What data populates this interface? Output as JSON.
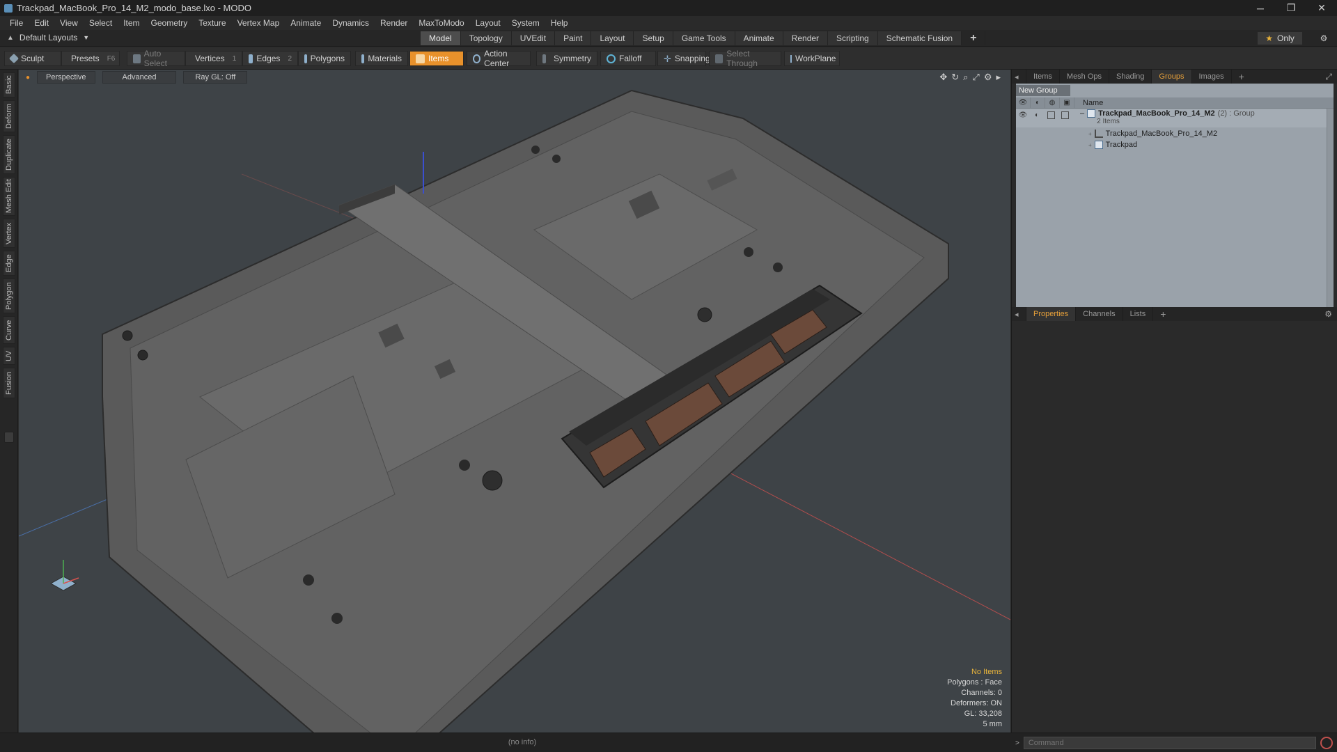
{
  "window": {
    "title": "Trackpad_MacBook_Pro_14_M2_modo_base.lxo - MODO",
    "minimize": "─",
    "restore": "❐",
    "close": "✕"
  },
  "menu": [
    "File",
    "Edit",
    "View",
    "Select",
    "Item",
    "Geometry",
    "Texture",
    "Vertex Map",
    "Animate",
    "Dynamics",
    "Render",
    "MaxToModo",
    "Layout",
    "System",
    "Help"
  ],
  "layouts": {
    "default_label": "Default Layouts",
    "tabs": [
      "Model",
      "Topology",
      "UVEdit",
      "Paint",
      "Layout",
      "Setup",
      "Game Tools",
      "Animate",
      "Render",
      "Scripting",
      "Schematic Fusion"
    ],
    "active_tab": "Model",
    "plus": "+",
    "only_label": "Only"
  },
  "toolbar": {
    "sculpt": "Sculpt",
    "presets": "Presets",
    "presets_key": "F6",
    "auto_select": "Auto Select",
    "vertices": "Vertices",
    "vertices_count": "1",
    "edges": "Edges",
    "edges_count": "2",
    "polygons": "Polygons",
    "materials": "Materials",
    "items": "Items",
    "action_center": "Action Center",
    "symmetry": "Symmetry",
    "falloff": "Falloff",
    "snapping": "Snapping",
    "select_through": "Select Through",
    "workplane": "WorkPlane"
  },
  "left_tabs": [
    "Basic",
    "Deform",
    "Duplicate",
    "Mesh Edit",
    "Vertex",
    "Edge",
    "Polygon",
    "Curve",
    "UV",
    "Fusion"
  ],
  "viewport": {
    "view_mode": "Perspective",
    "shading": "Advanced",
    "raygl": "Ray GL: Off",
    "info": {
      "no_items": "No Items",
      "polygons": "Polygons : Face",
      "channels": "Channels: 0",
      "deformers": "Deformers: ON",
      "gl": "GL: 33,208",
      "units": "5 mm"
    }
  },
  "right_panel": {
    "top_tabs": [
      "Items",
      "Mesh Ops",
      "Shading",
      "Groups",
      "Images"
    ],
    "active_top_tab": "Groups",
    "new_group": "New Group",
    "name_header": "Name",
    "group": {
      "name": "Trackpad_MacBook_Pro_14_M2",
      "count": "(2)",
      "type": ": Group",
      "sub": "2 Items",
      "children": [
        "Trackpad_MacBook_Pro_14_M2",
        "Trackpad"
      ]
    },
    "bottom_tabs": [
      "Properties",
      "Channels",
      "Lists"
    ],
    "active_bottom_tab": "Properties"
  },
  "status": {
    "info": "(no info)",
    "command_placeholder": "Command"
  },
  "colors": {
    "accent": "#e8912b",
    "viewport_bg": "#3e4347",
    "groups_bg": "#9aa2aa"
  }
}
